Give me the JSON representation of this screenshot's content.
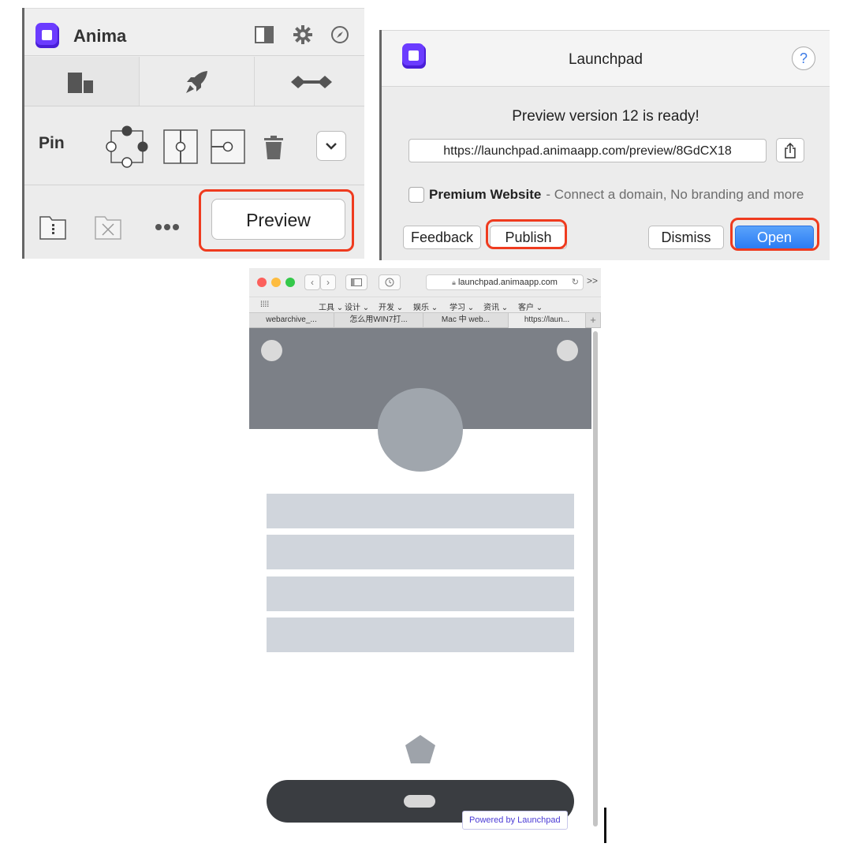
{
  "anima": {
    "title": "Anima",
    "pin_label": "Pin",
    "preview_label": "Preview",
    "icons": [
      "panel-icon",
      "gear-icon",
      "compass-icon",
      "layers-icon",
      "rocket-icon",
      "link-icon",
      "trash-icon",
      "chevron-down-icon",
      "folder-icon",
      "delete-icon",
      "ellipsis-icon"
    ]
  },
  "launchpad": {
    "title": "Launchpad",
    "help": "?",
    "message": "Preview version 12 is ready!",
    "url": "https://launchpad.animaapp.com/preview/8GdCX18",
    "premium_label": "Premium Website",
    "premium_desc": "- Connect a domain, No branding and more",
    "buttons": {
      "feedback": "Feedback",
      "publish": "Publish",
      "dismiss": "Dismiss",
      "open": "Open"
    },
    "accent_color": "#2b7cf3"
  },
  "browser": {
    "address": "launchpad.animaapp.com",
    "more": ">>",
    "bookmarks": [
      "工具 ⌄",
      "设计 ⌄",
      "开发 ⌄",
      "娱乐 ⌄",
      "学习 ⌄",
      "资讯 ⌄",
      "客户 ⌄"
    ],
    "grid": "⁞⁞⁞⁞",
    "tabs": [
      "webarchive_...",
      "怎么用WIN7打...",
      "Mac 中 web...",
      "https://laun..."
    ],
    "new_tab": "+",
    "powered_by": "Powered by Launchpad"
  },
  "highlight_color": "#ef3b1f"
}
